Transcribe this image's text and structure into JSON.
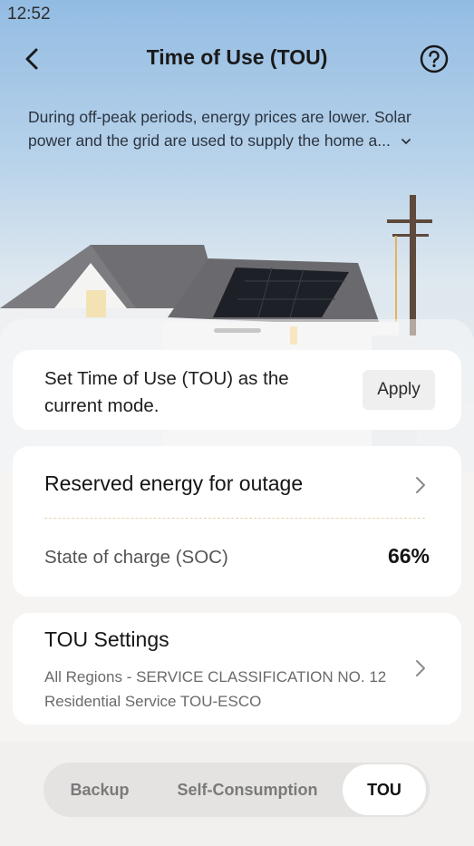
{
  "status_bar": {
    "time": "12:52"
  },
  "header": {
    "title": "Time of Use (TOU)"
  },
  "description": "During off-peak periods, energy prices are lower. Solar power and the grid are used to supply the home a...",
  "apply_card": {
    "text": "Set Time of Use (TOU) as the current mode.",
    "button_label": "Apply"
  },
  "reserve_card": {
    "title": "Reserved energy for outage",
    "soc_label": "State of charge (SOC)",
    "soc_value": "66%"
  },
  "tou_card": {
    "title": "TOU Settings",
    "line1": "All Regions - SERVICE CLASSIFICATION NO. 12",
    "line2": "Residential Service TOU-ESCO"
  },
  "mode_tabs": {
    "items": [
      "Backup",
      "Self-Consumption",
      "TOU"
    ],
    "selected": "TOU"
  },
  "icons": [
    "back-arrow-icon",
    "help-circle-icon",
    "chevron-down-icon",
    "chevron-right-icon"
  ]
}
